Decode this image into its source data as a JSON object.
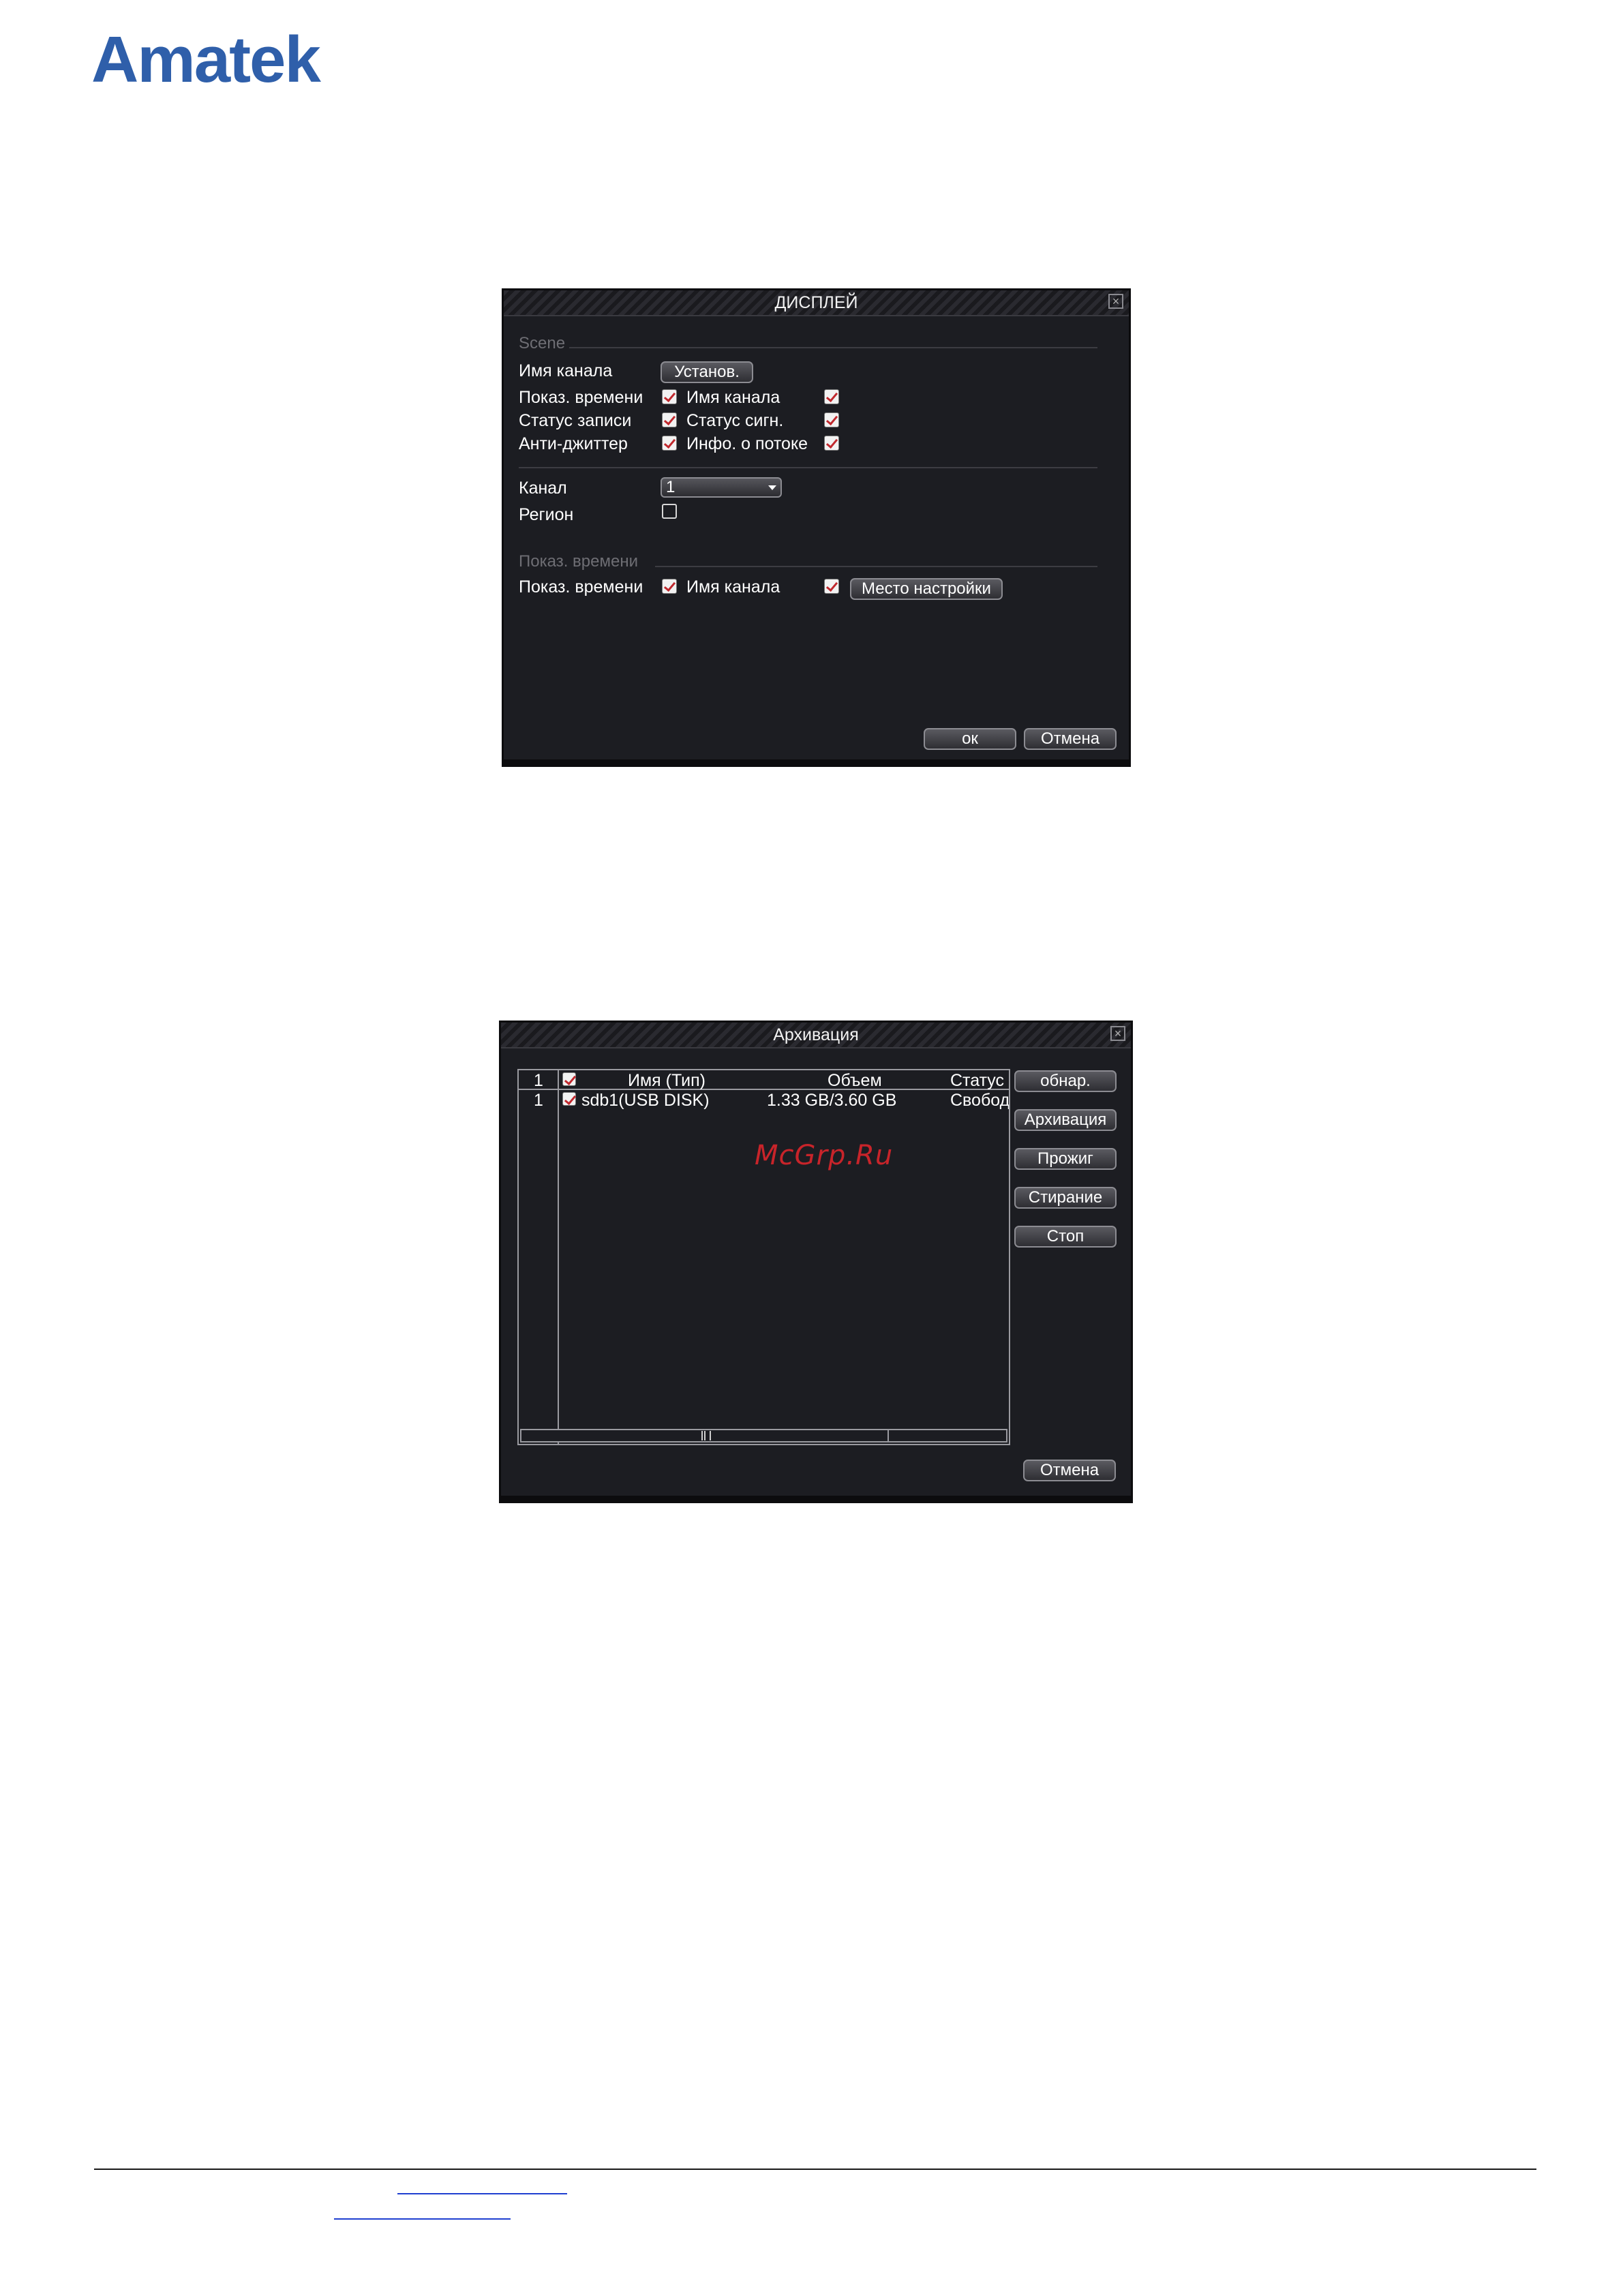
{
  "brand": {
    "logo_text": "Amatek",
    "logo_color": "#2f5faa"
  },
  "display_dialog": {
    "title": "ДИСПЛЕЙ",
    "scene_section": "Scene",
    "channel_name_label": "Имя канала",
    "set_button": "Установ.",
    "rows": [
      {
        "left_label": "Показ. времени",
        "left_checked": true,
        "right_label": "Имя канала",
        "right_checked": true
      },
      {
        "left_label": "Статус записи",
        "left_checked": true,
        "right_label": "Статус сигн.",
        "right_checked": true
      },
      {
        "left_label": "Анти-джиттер",
        "left_checked": true,
        "right_label": "Инфо. о потоке",
        "right_checked": true
      }
    ],
    "channel_label": "Канал",
    "channel_value": "1",
    "region_label": "Регион",
    "region_checked": false,
    "time_section": "Показ. времени",
    "time_row": {
      "left_label": "Показ. времени",
      "left_checked": true,
      "right_label": "Имя канала",
      "right_checked": true
    },
    "location_button": "Место настройки",
    "ok_button": "ок",
    "cancel_button": "Отмена"
  },
  "archive_dialog": {
    "title": "Архивация",
    "columns": [
      "1",
      "Имя (Тип)",
      "Объем",
      "Статус"
    ],
    "rows": [
      {
        "num": "1",
        "checked": true,
        "name": "sdb1(USB DISK)",
        "volume": "1.33 GB/3.60 GB",
        "status": "Свобод"
      }
    ],
    "buttons": [
      "обнар.",
      "Архивация",
      "Прожиг",
      "Стирание",
      "Стоп"
    ],
    "cancel_button": "Отмена",
    "watermark": "McGrp.Ru"
  },
  "colors": {
    "dialog_bg": "#1c1d22",
    "check_mark": "#c0282d",
    "footer_link": "#1f3fd0"
  }
}
